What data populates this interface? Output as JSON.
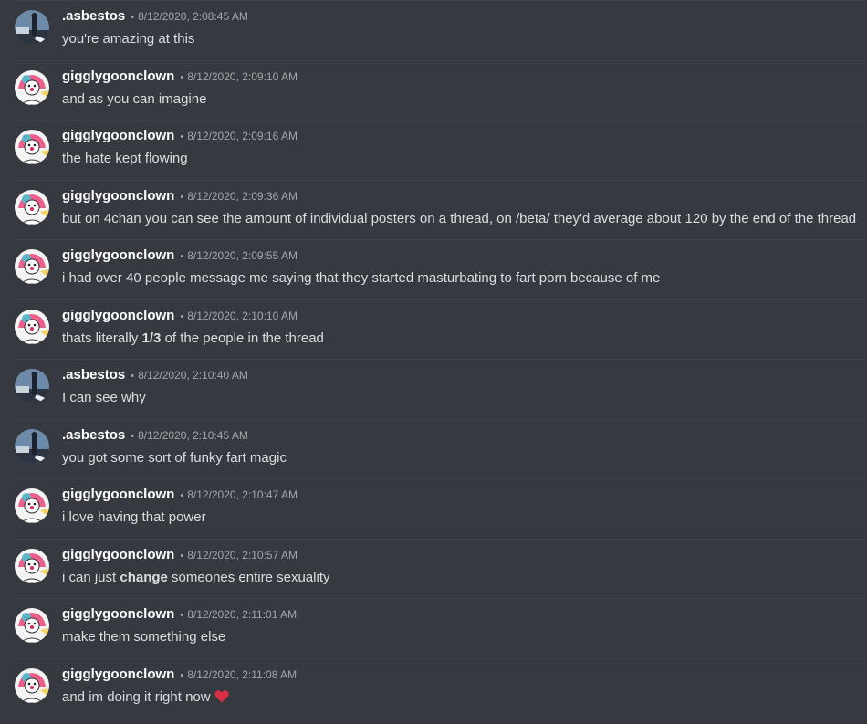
{
  "colors": {
    "background": "#36393f",
    "username": "#ffffff",
    "timestamp": "#a3a6aa",
    "text": "#dcddde",
    "divider": "#40434a",
    "heart": "#dd2e44"
  },
  "separator": "•",
  "messages": [
    {
      "author": ".asbestos",
      "avatar": "asbestos-avatar",
      "timestamp": "8/12/2020, 2:08:45 AM",
      "text": "you're amazing at this"
    },
    {
      "author": "gigglygoonclown",
      "avatar": "clown-avatar",
      "timestamp": "8/12/2020, 2:09:10 AM",
      "text": "and as you can imagine"
    },
    {
      "author": "gigglygoonclown",
      "avatar": "clown-avatar",
      "timestamp": "8/12/2020, 2:09:16 AM",
      "text": "the hate kept flowing"
    },
    {
      "author": "gigglygoonclown",
      "avatar": "clown-avatar",
      "timestamp": "8/12/2020, 2:09:36 AM",
      "text": "but on 4chan you can see the amount of individual posters on a thread, on /beta/ they'd average about 120 by the end of the thread"
    },
    {
      "author": "gigglygoonclown",
      "avatar": "clown-avatar",
      "timestamp": "8/12/2020, 2:09:55 AM",
      "text": "i had over 40 people message me saying that they started masturbating to fart porn because of me"
    },
    {
      "author": "gigglygoonclown",
      "avatar": "clown-avatar",
      "timestamp": "8/12/2020, 2:10:10 AM",
      "text_before": "thats literally ",
      "text_bold": "1/3",
      "text_after": " of the people in the thread"
    },
    {
      "author": ".asbestos",
      "avatar": "asbestos-avatar",
      "timestamp": "8/12/2020, 2:10:40 AM",
      "text": "I can see why"
    },
    {
      "author": ".asbestos",
      "avatar": "asbestos-avatar",
      "timestamp": "8/12/2020, 2:10:45 AM",
      "text": "you got some sort of funky fart magic"
    },
    {
      "author": "gigglygoonclown",
      "avatar": "clown-avatar",
      "timestamp": "8/12/2020, 2:10:47 AM",
      "text": "i love having that power"
    },
    {
      "author": "gigglygoonclown",
      "avatar": "clown-avatar",
      "timestamp": "8/12/2020, 2:10:57 AM",
      "text_before": "i can just ",
      "text_bold": "change",
      "text_after": " someones entire sexuality"
    },
    {
      "author": "gigglygoonclown",
      "avatar": "clown-avatar",
      "timestamp": "8/12/2020, 2:11:01 AM",
      "text": "make them something else"
    },
    {
      "author": "gigglygoonclown",
      "avatar": "clown-avatar",
      "timestamp": "8/12/2020, 2:11:08 AM",
      "text": "and im doing it right now",
      "emoji": "heart-icon"
    }
  ]
}
